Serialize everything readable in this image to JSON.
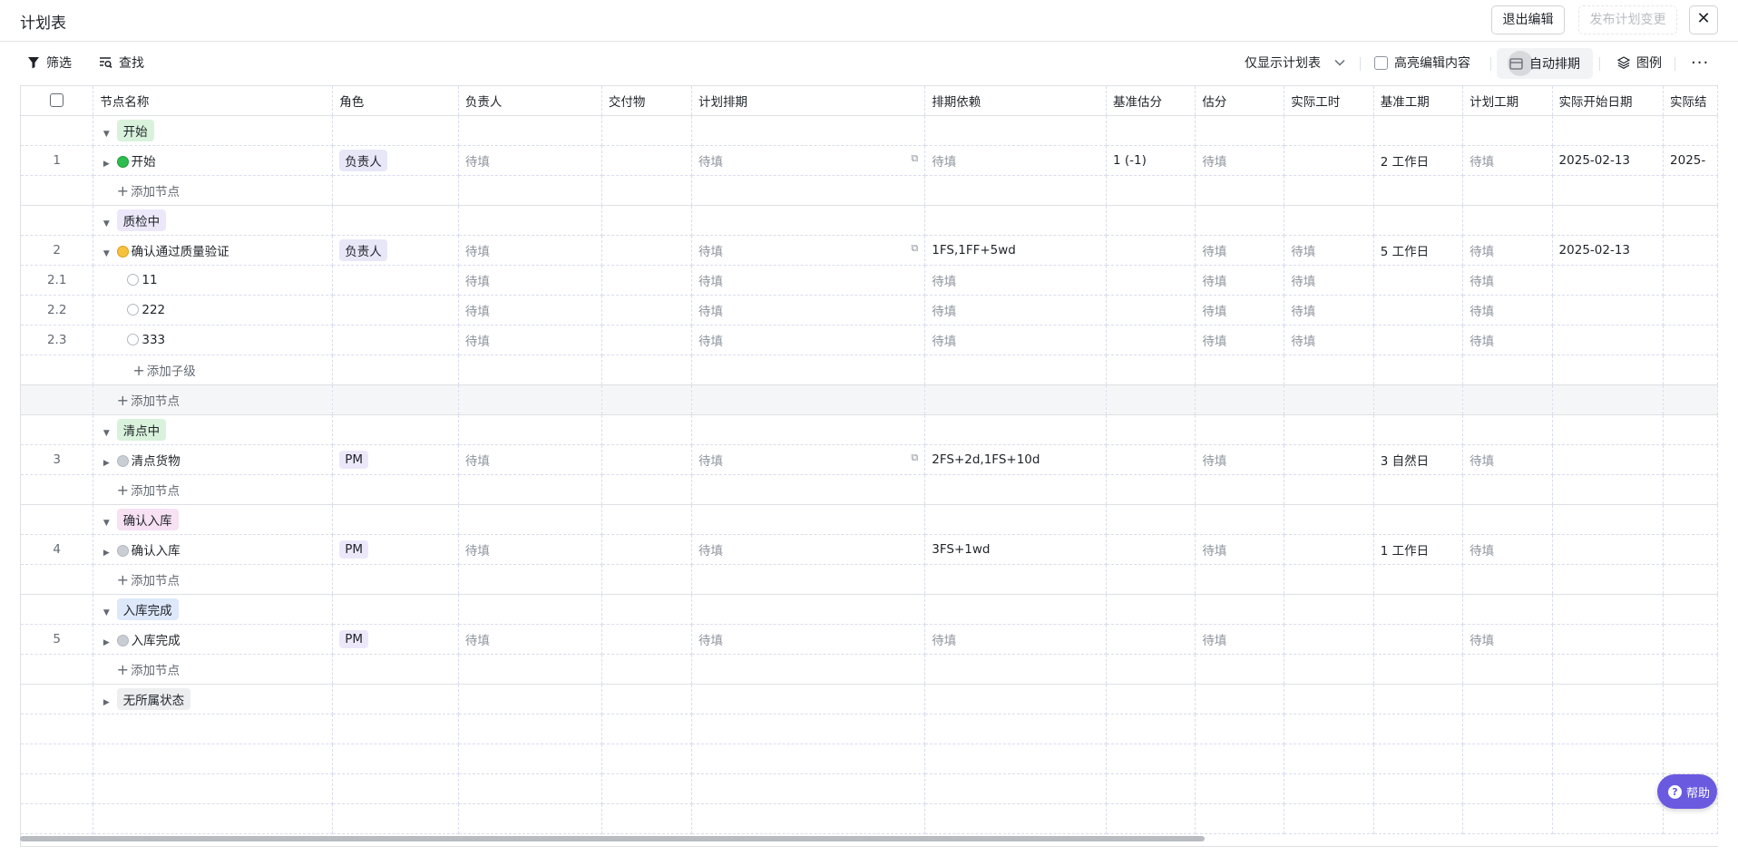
{
  "header": {
    "title": "计划表",
    "exit_edit": "退出编辑",
    "publish_change": "发布计划变更",
    "close": "✕"
  },
  "toolbar": {
    "filter": "筛选",
    "find": "查找",
    "view_select": "仅显示计划表",
    "highlight_edit": "高亮编辑内容",
    "auto_schedule": "自动排期",
    "legend": "图例",
    "more": "···"
  },
  "columns": [
    "节点名称",
    "角色",
    "负责人",
    "交付物",
    "计划排期",
    "排期依赖",
    "基准估分",
    "估分",
    "实际工时",
    "基准工期",
    "计划工期",
    "实际开始日期",
    "实际结"
  ],
  "placeholder": "待填",
  "add_node": "添加节点",
  "add_child": "添加子级",
  "groups": [
    {
      "label": "开始",
      "color": "#d9f2dc"
    },
    {
      "label": "质检中",
      "color": "#ece8fa"
    },
    {
      "label": "清点中",
      "color": "#d9f2dc"
    },
    {
      "label": "确认入库",
      "color": "#f7e1f3"
    },
    {
      "label": "入库完成",
      "color": "#dde8fa"
    },
    {
      "label": "无所属状态",
      "color": "#eceef0"
    }
  ],
  "rows": {
    "r1": {
      "idx": "1",
      "name": "开始",
      "role": "负责人",
      "dep": "待填",
      "base_est": "1 (-1)",
      "base_dur": "2 工作日",
      "start": "2025-02-13",
      "end": "2025-"
    },
    "r2": {
      "idx": "2",
      "name": "确认通过质量验证",
      "role": "负责人",
      "dep": "1FS,1FF+5wd",
      "base_dur": "5 工作日",
      "start": "2025-02-13"
    },
    "r21": {
      "idx": "2.1",
      "name": "11"
    },
    "r22": {
      "idx": "2.2",
      "name": "222"
    },
    "r23": {
      "idx": "2.3",
      "name": "333"
    },
    "r3": {
      "idx": "3",
      "name": "清点货物",
      "role": "PM",
      "dep": "2FS+2d,1FS+10d",
      "base_dur": "3 自然日"
    },
    "r4": {
      "idx": "4",
      "name": "确认入库",
      "role": "PM",
      "dep": "3FS+1wd",
      "base_dur": "1 工作日"
    },
    "r5": {
      "idx": "5",
      "name": "入库完成",
      "role": "PM",
      "dep": "待填"
    }
  },
  "help": "帮助"
}
